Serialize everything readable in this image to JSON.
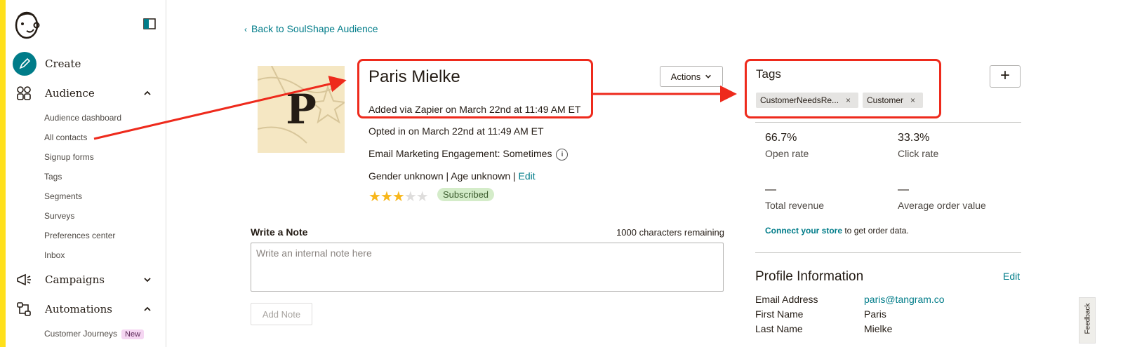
{
  "colors": {
    "accent": "#ffe01b",
    "teal": "#007c89",
    "annotation": "#ee2a1c",
    "subscribed_bg": "#d4ecc9"
  },
  "sidebar": {
    "logo_icon": "mailchimp-freddie-icon",
    "collapse_icon": "sidebar-collapse-icon",
    "create": {
      "label": "Create",
      "icon": "pencil-icon"
    },
    "audience": {
      "label": "Audience",
      "icon": "audience-icon",
      "items": [
        {
          "label": "Audience dashboard"
        },
        {
          "label": "All contacts"
        },
        {
          "label": "Signup forms"
        },
        {
          "label": "Tags"
        },
        {
          "label": "Segments"
        },
        {
          "label": "Surveys"
        },
        {
          "label": "Preferences center"
        },
        {
          "label": "Inbox"
        }
      ]
    },
    "campaigns": {
      "label": "Campaigns",
      "icon": "megaphone-icon"
    },
    "automations": {
      "label": "Automations",
      "icon": "automations-icon",
      "items": [
        {
          "label": "Customer Journeys",
          "badge": "New"
        }
      ]
    }
  },
  "main": {
    "back_link": "Back to SoulShape Audience",
    "avatar_letter": "P",
    "contact": {
      "name": "Paris Mielke",
      "added_via": "Added via Zapier on March 22nd at 11:49 AM ET",
      "opted_in": "Opted in on March 22nd at 11:49 AM ET",
      "engagement": "Email Marketing Engagement: Sometimes",
      "demographics": "Gender unknown | Age unknown | ",
      "demographics_edit": "Edit",
      "rating": 3,
      "rating_max": 5,
      "status": "Subscribed"
    },
    "actions_label": "Actions",
    "note": {
      "title": "Write a Note",
      "remaining": "1000 characters remaining",
      "placeholder": "Write an internal note here",
      "button": "Add Note"
    }
  },
  "right": {
    "tags_title": "Tags",
    "tags": [
      {
        "label": "CustomerNeedsRe..."
      },
      {
        "label": "Customer"
      }
    ],
    "tag_remove": "×",
    "add_tag": "+",
    "stats": {
      "open_rate_value": "66.7%",
      "open_rate_label": "Open rate",
      "click_rate_value": "33.3%",
      "click_rate_label": "Click rate",
      "revenue_value": "—",
      "revenue_label": "Total revenue",
      "aov_value": "—",
      "aov_label": "Average order value"
    },
    "store_link": "Connect your store",
    "store_text": " to get order data.",
    "profile": {
      "title": "Profile Information",
      "edit": "Edit",
      "fields": [
        {
          "label": "Email Address",
          "value": "paris@tangram.co"
        },
        {
          "label": "First Name",
          "value": "Paris"
        },
        {
          "label": "Last Name",
          "value": "Mielke"
        }
      ]
    }
  },
  "feedback_label": "Feedback"
}
